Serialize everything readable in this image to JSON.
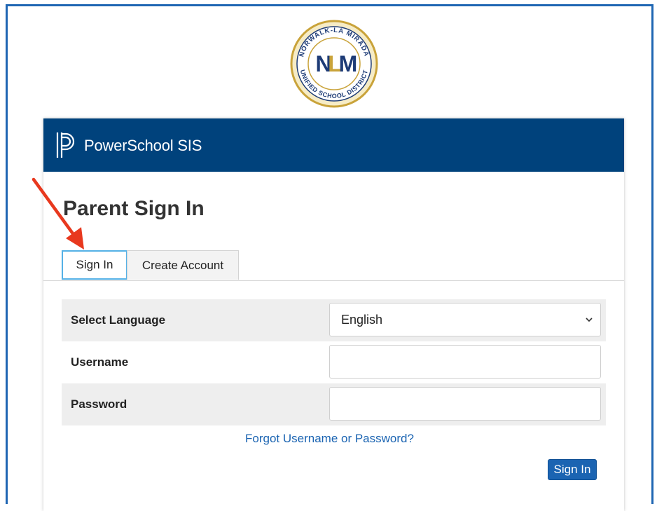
{
  "seal": {
    "initials": "NLM",
    "ring_text": "NORWALK-LA MIRADA · UNIFIED SCHOOL DISTRICT"
  },
  "header": {
    "brand": "PowerSchool SIS"
  },
  "page": {
    "title": "Parent Sign In"
  },
  "tabs": [
    {
      "label": "Sign In",
      "active": true
    },
    {
      "label": "Create Account",
      "active": false
    }
  ],
  "form": {
    "language": {
      "label": "Select Language",
      "value": "English"
    },
    "username": {
      "label": "Username",
      "value": ""
    },
    "password": {
      "label": "Password",
      "value": ""
    }
  },
  "links": {
    "forgot": "Forgot Username or Password?"
  },
  "actions": {
    "sign_in": "Sign In"
  },
  "icons": {
    "logo": "powerschool-logo-icon",
    "dropdown": "chevron-down-icon",
    "annotation": "red-arrow-icon"
  },
  "colors": {
    "header_bg": "#00427c",
    "link": "#1b64b2",
    "active_tab_border": "#55b1e6",
    "frame_border": "#1f66b3",
    "annotation_arrow": "#e8381e",
    "seal_gold": "#c9a33a",
    "seal_navy": "#1d3b76"
  }
}
